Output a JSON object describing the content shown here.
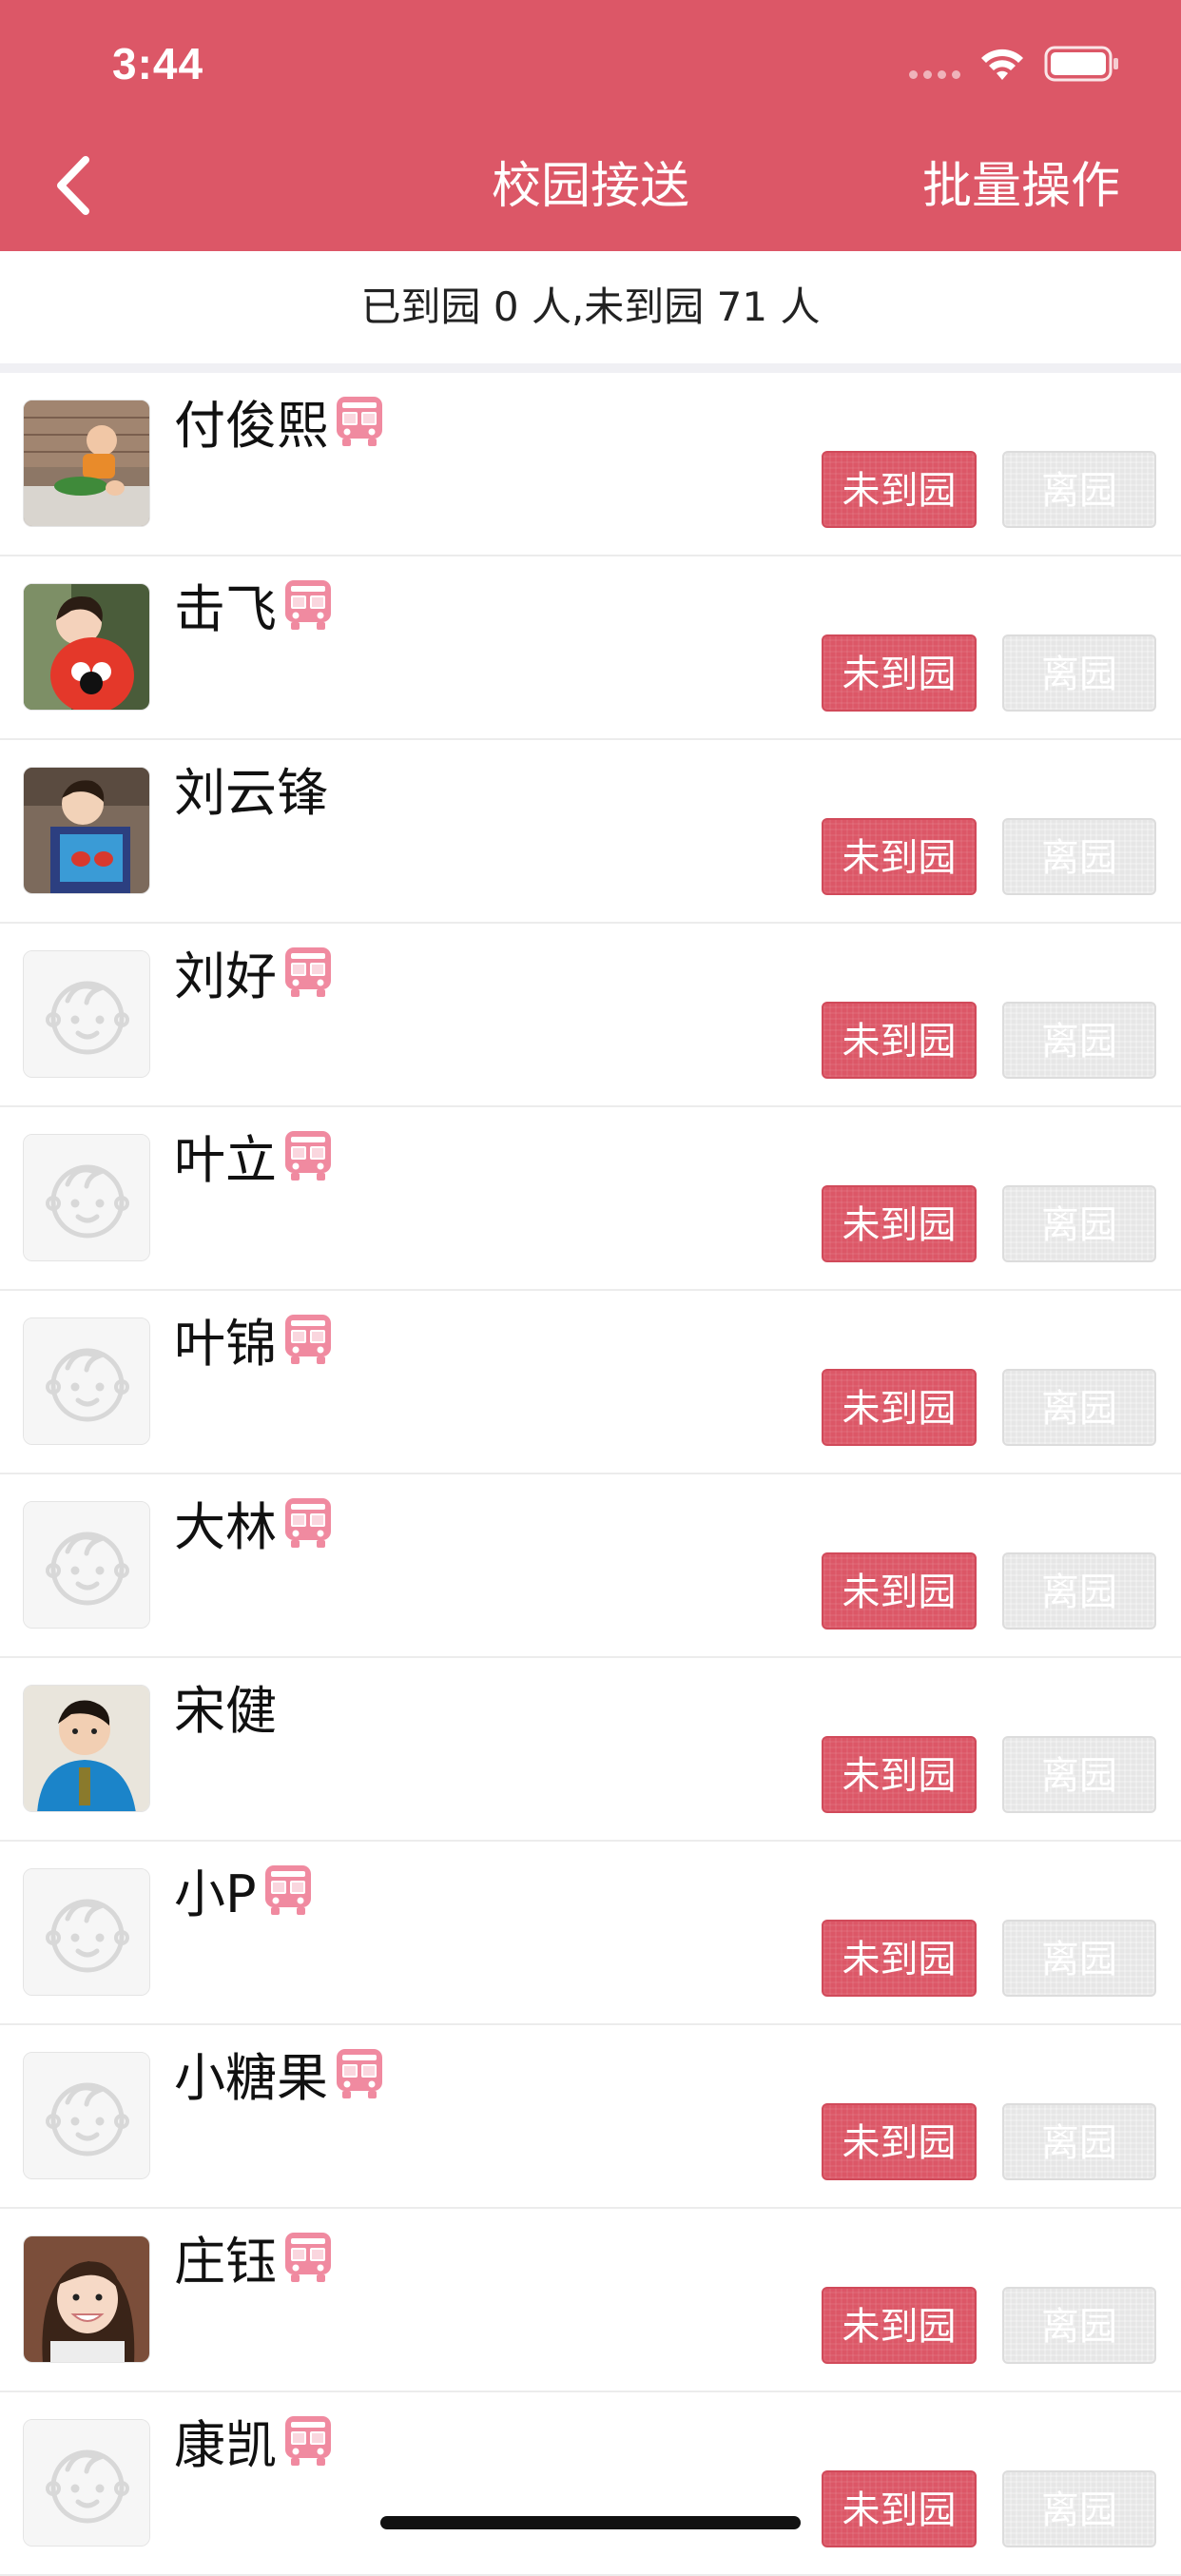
{
  "status_bar": {
    "time": "3:44"
  },
  "nav": {
    "title": "校园接送",
    "batch_label": "批量操作"
  },
  "summary": "已到园 0 人,未到园 71 人",
  "colors": {
    "primary": "#dc5767",
    "inactive_button": "#e6e6e6"
  },
  "students": [
    {
      "name": "付俊熙",
      "bus": true,
      "avatar": "photo-baby-crawling",
      "absent_label": "未到园",
      "leave_label": "离园"
    },
    {
      "name": "击飞",
      "bus": true,
      "avatar": "photo-girl-red",
      "absent_label": "未到园",
      "leave_label": "离园"
    },
    {
      "name": "刘云锋",
      "bus": false,
      "avatar": "photo-boy-book",
      "absent_label": "未到园",
      "leave_label": "离园"
    },
    {
      "name": "刘好",
      "bus": true,
      "avatar": "placeholder",
      "absent_label": "未到园",
      "leave_label": "离园"
    },
    {
      "name": "叶立",
      "bus": true,
      "avatar": "placeholder",
      "absent_label": "未到园",
      "leave_label": "离园"
    },
    {
      "name": "叶锦",
      "bus": true,
      "avatar": "placeholder",
      "absent_label": "未到园",
      "leave_label": "离园"
    },
    {
      "name": "大林",
      "bus": true,
      "avatar": "placeholder",
      "absent_label": "未到园",
      "leave_label": "离园"
    },
    {
      "name": "宋健",
      "bus": false,
      "avatar": "photo-child-blue",
      "absent_label": "未到园",
      "leave_label": "离园"
    },
    {
      "name": "小P",
      "bus": true,
      "avatar": "placeholder",
      "absent_label": "未到园",
      "leave_label": "离园"
    },
    {
      "name": "小糖果",
      "bus": true,
      "avatar": "placeholder",
      "absent_label": "未到园",
      "leave_label": "离园"
    },
    {
      "name": "庄钰",
      "bus": true,
      "avatar": "photo-girl-smile",
      "absent_label": "未到园",
      "leave_label": "离园"
    },
    {
      "name": "康凯",
      "bus": true,
      "avatar": "placeholder",
      "absent_label": "未到园",
      "leave_label": "离园"
    }
  ]
}
